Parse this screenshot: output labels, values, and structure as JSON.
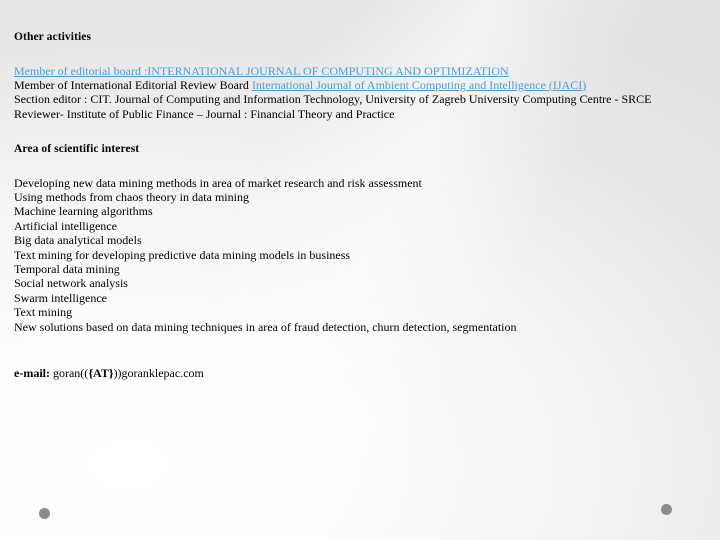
{
  "slide": {
    "background_color": "#ededed",
    "link_color": "#4F9CD4",
    "text_color": "#000000"
  },
  "other_activities": {
    "heading": "Other activities",
    "entries": [
      {
        "prefix": "",
        "link": "Member of editorial board  :INTERNATIONAL JOURNAL OF COMPUTING AND OPTIMIZATION",
        "suffix": ""
      },
      {
        "prefix": "Member of International Editorial Review Board ",
        "link": "International Journal of Ambient Computing and Intelligence (IJACI)",
        "suffix": ""
      },
      {
        "prefix": "Section editor : CIT. Journal of Computing and Information Technology, University of Zagreb University Computing Centre - SRCE",
        "link": "",
        "suffix": ""
      },
      {
        "prefix": "Reviewer-  Institute of Public Finance – Journal : Financial Theory and Practice",
        "link": "",
        "suffix": ""
      }
    ]
  },
  "area_of_interest": {
    "heading": "Area of scientific interest",
    "items": [
      "Developing new data mining methods in area of market research and risk assessment",
      "Using methods from chaos theory in data mining",
      "Machine learning algorithms",
      "Artificial intelligence",
      "Big data analytical models",
      "Text mining for developing predictive data mining models in business",
      "Temporal data mining",
      "Social network analysis",
      "Swarm intelligence",
      "Text mining",
      "New solutions based on data mining techniques in area of fraud detection, churn detection, segmentation"
    ]
  },
  "contact": {
    "label": "e-mail:",
    "value_before": " goran((",
    "at_token": "{AT}",
    "value_after": "))goranklepac.com"
  },
  "decoration": {
    "dot_color": "#8c8c8c",
    "dot_left_name": "decorative-dot-left",
    "dot_right_name": "decorative-dot-right"
  }
}
